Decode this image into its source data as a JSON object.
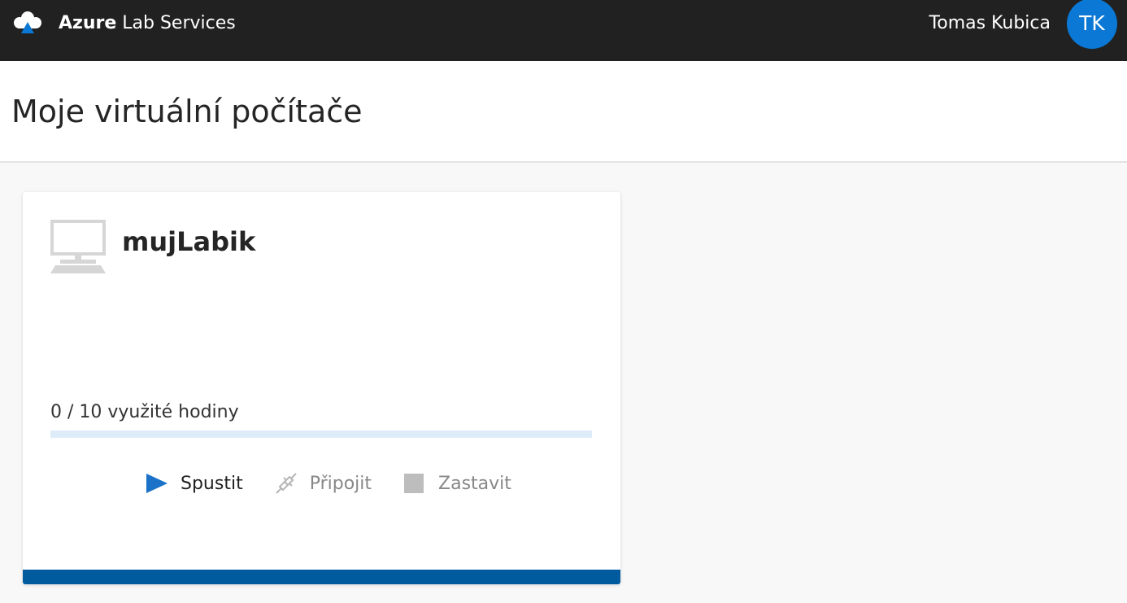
{
  "header": {
    "brand_bold": "Azure",
    "brand_rest": "Lab Services",
    "user_name": "Tomas Kubica",
    "avatar_initials": "TK",
    "avatar_color": "#0a78d4",
    "logo_icon": "azure-lab-cloud-icon"
  },
  "page": {
    "title": "Moje virtuální počítače"
  },
  "vm_card": {
    "icon": "computer-monitor-icon",
    "name": "mujLabik",
    "usage_text": "0 / 10 využité hodiny",
    "usage_used": 0,
    "usage_total": 10,
    "accent_color": "#005a9e",
    "actions": {
      "start_label": "Spustit",
      "start_icon": "play-icon",
      "connect_label": "Připojit",
      "connect_icon": "plug-icon",
      "stop_label": "Zastavit",
      "stop_icon": "stop-square-icon"
    }
  }
}
